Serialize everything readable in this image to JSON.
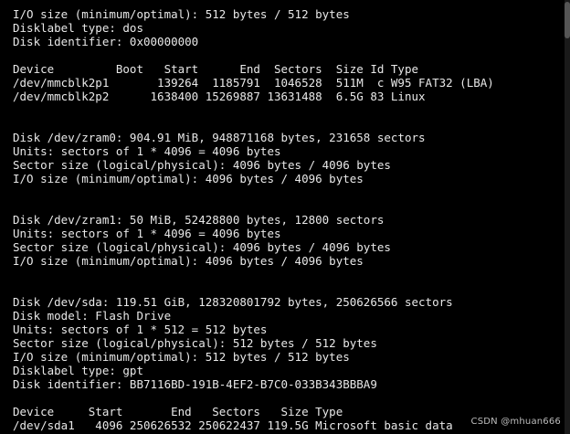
{
  "terminal": {
    "lines": [
      "I/O size (minimum/optimal): 512 bytes / 512 bytes",
      "Disklabel type: dos",
      "Disk identifier: 0x00000000",
      "",
      "Device         Boot   Start      End  Sectors  Size Id Type",
      "/dev/mmcblk2p1       139264  1185791  1046528  511M  c W95 FAT32 (LBA)",
      "/dev/mmcblk2p2      1638400 15269887 13631488  6.5G 83 Linux",
      "",
      "",
      "Disk /dev/zram0: 904.91 MiB, 948871168 bytes, 231658 sectors",
      "Units: sectors of 1 * 4096 = 4096 bytes",
      "Sector size (logical/physical): 4096 bytes / 4096 bytes",
      "I/O size (minimum/optimal): 4096 bytes / 4096 bytes",
      "",
      "",
      "Disk /dev/zram1: 50 MiB, 52428800 bytes, 12800 sectors",
      "Units: sectors of 1 * 4096 = 4096 bytes",
      "Sector size (logical/physical): 4096 bytes / 4096 bytes",
      "I/O size (minimum/optimal): 4096 bytes / 4096 bytes",
      "",
      "",
      "Disk /dev/sda: 119.51 GiB, 128320801792 bytes, 250626566 sectors",
      "Disk model: Flash Drive",
      "Units: sectors of 1 * 512 = 512 bytes",
      "Sector size (logical/physical): 512 bytes / 512 bytes",
      "I/O size (minimum/optimal): 512 bytes / 512 bytes",
      "Disklabel type: gpt",
      "Disk identifier: BB7116BD-191B-4EF2-B7C0-033B343BBBA9",
      "",
      "Device     Start       End   Sectors   Size Type",
      "/dev/sda1   4096 250626532 250622437 119.5G Microsoft basic data"
    ]
  },
  "watermark": {
    "text": "CSDN @mhuan666"
  },
  "colors": {
    "background": "#000000",
    "foreground": "#e8e8e8",
    "watermark": "#bdbdbd"
  }
}
